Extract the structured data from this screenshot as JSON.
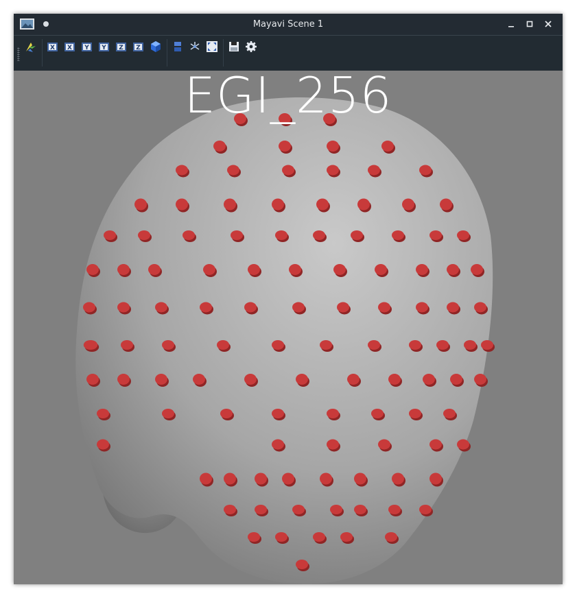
{
  "window": {
    "title": "Mayavi Scene 1",
    "controls": [
      "minimize-icon",
      "maximize-icon",
      "close-icon"
    ]
  },
  "toolbar": {
    "buttons": [
      {
        "name": "mayavi-engine-icon"
      },
      {
        "name": "view-plus-x-icon",
        "label": "X"
      },
      {
        "name": "view-minus-x-icon",
        "label": "X"
      },
      {
        "name": "view-plus-y-icon",
        "label": "Y"
      },
      {
        "name": "view-minus-y-icon",
        "label": "Y"
      },
      {
        "name": "view-plus-z-icon",
        "label": "Z"
      },
      {
        "name": "view-minus-z-icon",
        "label": "Z"
      },
      {
        "name": "isometric-view-icon"
      },
      {
        "name": "parallel-projection-icon"
      },
      {
        "name": "axes-indicator-icon"
      },
      {
        "name": "full-screen-icon"
      },
      {
        "name": "save-scene-icon"
      },
      {
        "name": "configure-scene-icon"
      }
    ]
  },
  "scene": {
    "title": "EGI_256",
    "background_color": "#808080",
    "head_color": "#b4b4b4",
    "electrode_color": "#c83a3a"
  }
}
